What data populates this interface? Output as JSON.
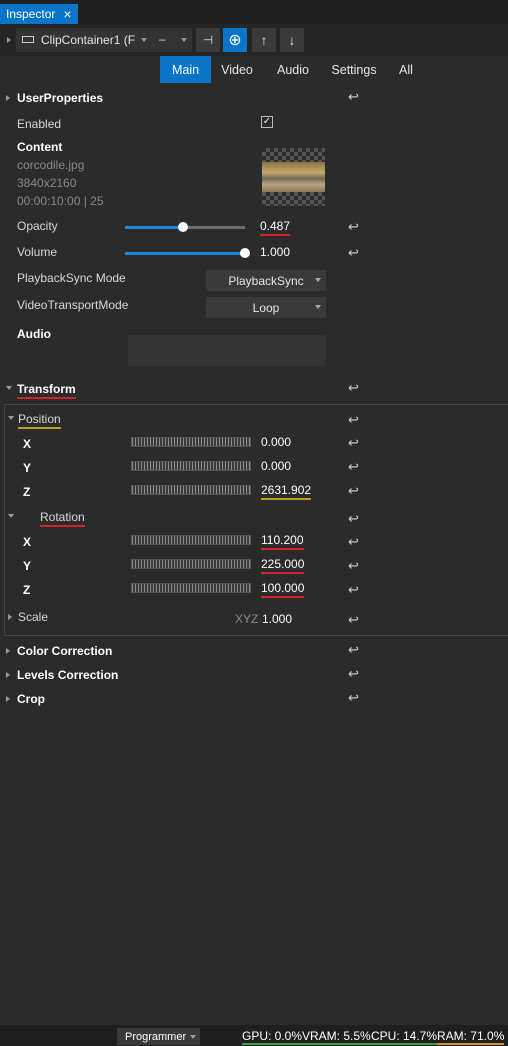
{
  "window": {
    "tab_title": "Inspector",
    "close_icon": "close-icon"
  },
  "toolbar": {
    "container_name": "ClipContainer1 (F",
    "dash": "–"
  },
  "tabs": [
    "Main",
    "Video",
    "Audio",
    "Settings",
    "All"
  ],
  "user_properties": {
    "header": "UserProperties",
    "enabled_label": "Enabled",
    "enabled_checked": true,
    "content_label": "Content",
    "file_name": "corcodile.jpg",
    "resolution": "3840x2160",
    "timecode": "00:00:10:00 | 25",
    "opacity_label": "Opacity",
    "opacity_value": "0.487",
    "opacity_fraction": 0.487,
    "volume_label": "Volume",
    "volume_value": "1.000",
    "volume_fraction": 1.0,
    "playback_sync_label": "PlaybackSync Mode",
    "playback_sync_value": "PlaybackSync",
    "video_transport_label": "VideoTransportMode",
    "video_transport_value": "Loop",
    "audio_label": "Audio"
  },
  "transform": {
    "header": "Transform",
    "position": {
      "label": "Position",
      "x_label": "X",
      "x": "0.000",
      "y_label": "Y",
      "y": "0.000",
      "z_label": "Z",
      "z": "2631.902"
    },
    "rotation": {
      "label": "Rotation",
      "x_label": "X",
      "x": "110.200",
      "y_label": "Y",
      "y": "225.000",
      "z_label": "Z",
      "z": "100.000"
    },
    "scale": {
      "label": "Scale",
      "xyz_label": "XYZ",
      "value": "1.000"
    }
  },
  "sections": {
    "color_correction": "Color Correction",
    "levels_correction": "Levels Correction",
    "crop": "Crop"
  },
  "status": {
    "mode": "Programmer",
    "gpu": "GPU: 0.0%",
    "vram": "VRAM: 5.5%",
    "cpu": "CPU: 14.7%",
    "ram": "RAM: 71.0%"
  },
  "colors": {
    "accent": "#0a74c8",
    "background": "#2b2b2b",
    "red_underline": "#c9272a",
    "yellow_underline": "#b8a01c"
  }
}
